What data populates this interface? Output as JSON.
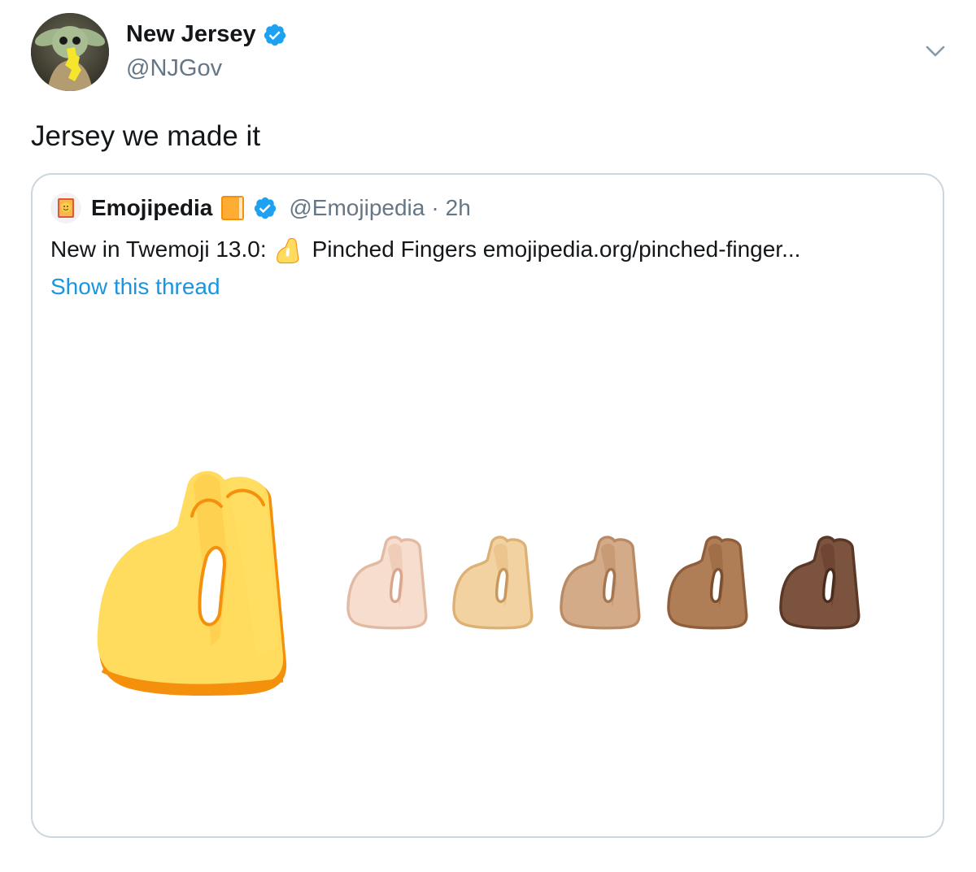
{
  "tweet": {
    "display_name": "New Jersey",
    "handle": "@NJGov",
    "text": "Jersey we made it"
  },
  "quoted": {
    "display_name": "Emojipedia",
    "handle": "@Emojipedia",
    "separator": "·",
    "time": "2h",
    "text_before": "New in Twemoji 13.0:",
    "text_after": "Pinched Fingers emojipedia.org/pinched-finger...",
    "show_thread": "Show this thread"
  },
  "icons": {
    "verified": "verified-badge-icon",
    "chevron": "chevron-down-icon",
    "book": "orange-book-icon",
    "emoji": "pinched-fingers-emoji"
  },
  "colors": {
    "link": "#1b95e0",
    "verified": "#1da1f2",
    "border": "#ccd6dd",
    "muted": "#657786",
    "skin_default": "#FFDC5D",
    "skin_tones": [
      "#F6DDCD",
      "#F3D2A2",
      "#D4AB88",
      "#AF7E57",
      "#7C533E"
    ]
  }
}
